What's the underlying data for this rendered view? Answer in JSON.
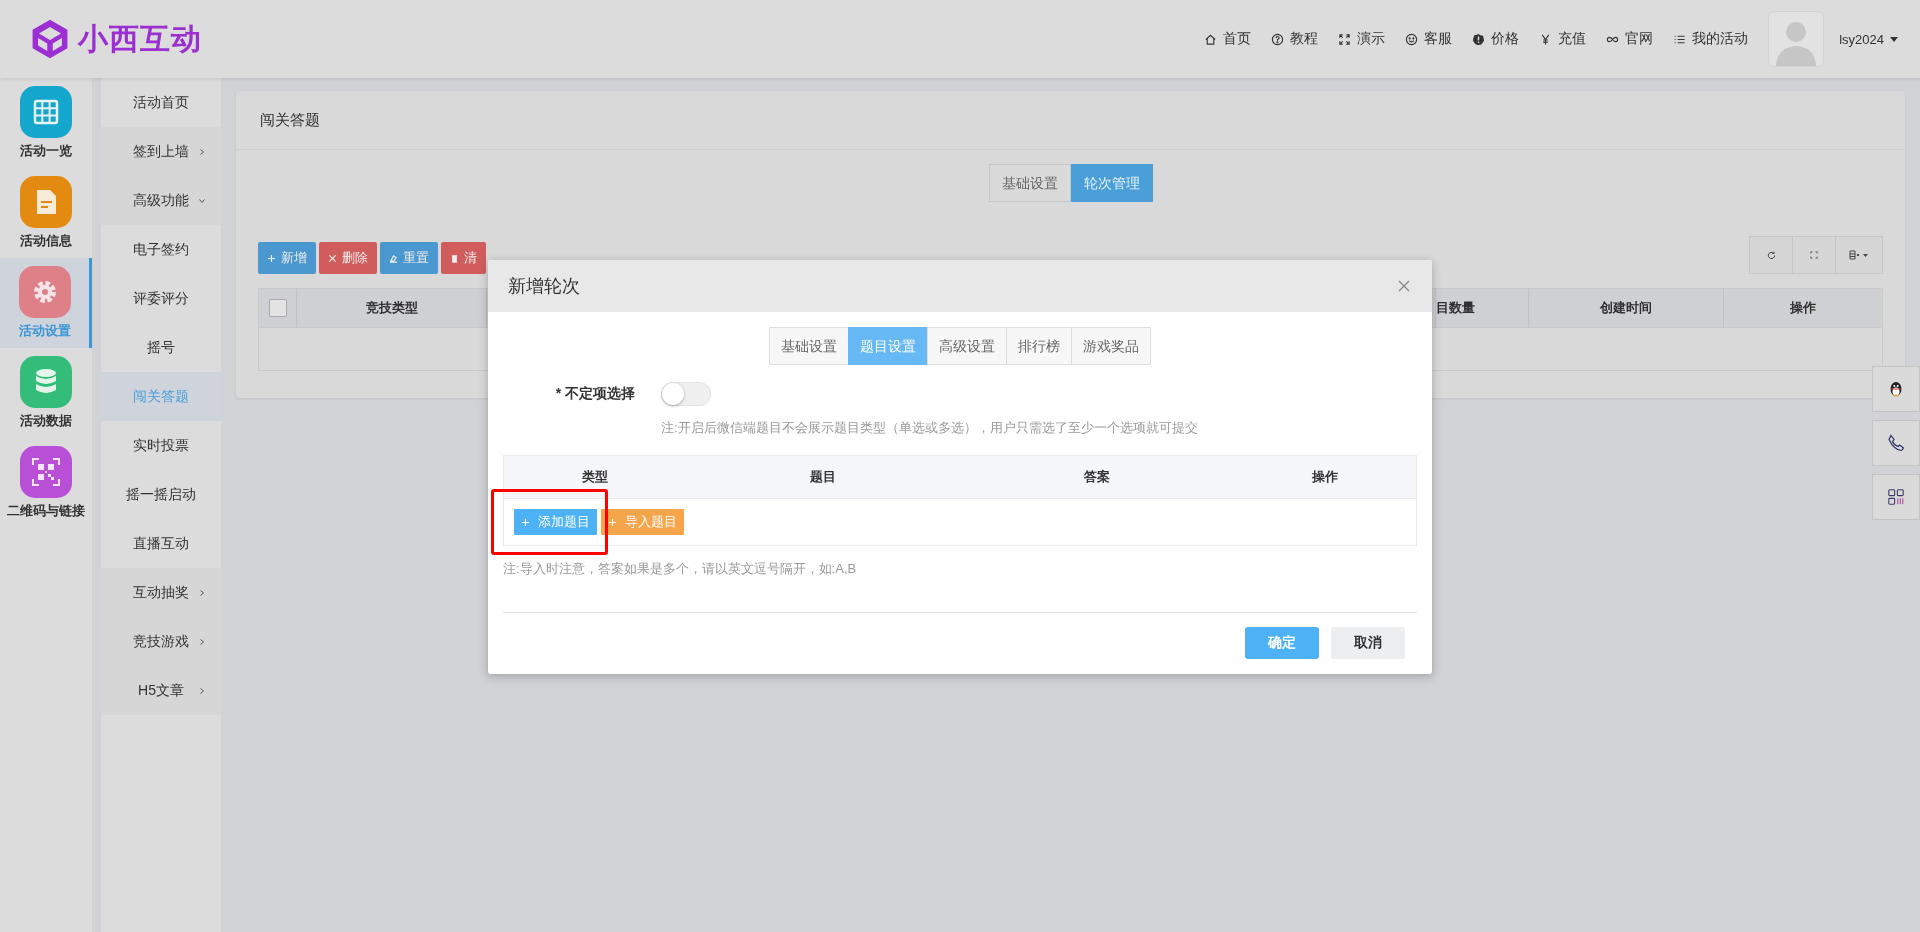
{
  "logo": {
    "text": "小西互动"
  },
  "top_nav": [
    {
      "kind": "home",
      "label": "首页"
    },
    {
      "kind": "help",
      "label": "教程"
    },
    {
      "kind": "expand",
      "label": "演示"
    },
    {
      "kind": "smile",
      "label": "客服"
    },
    {
      "kind": "alert",
      "label": "价格"
    },
    {
      "kind": "yen",
      "label": "充值"
    },
    {
      "kind": "infinity",
      "label": "官网"
    },
    {
      "kind": "list",
      "label": "我的活动"
    }
  ],
  "user": {
    "name": "lsy2024"
  },
  "app_nav": [
    {
      "kind": "grid",
      "label": "活动一览",
      "color": "#14a6cc",
      "selected": false
    },
    {
      "kind": "doc",
      "label": "活动信息",
      "color": "#e38a10",
      "selected": false
    },
    {
      "kind": "gear",
      "label": "活动设置",
      "color": "#de8088",
      "selected": true
    },
    {
      "kind": "database",
      "label": "活动数据",
      "color": "#33bd79",
      "selected": false
    },
    {
      "kind": "qr",
      "label": "二维码与链接",
      "color": "#b84fd6",
      "selected": false
    }
  ],
  "sub_nav": [
    {
      "kind": "link",
      "label": "活动首页",
      "selected": false
    },
    {
      "kind": "group",
      "label": "签到上墙",
      "expanded": false
    },
    {
      "kind": "group",
      "label": "高级功能",
      "expanded": true,
      "children": [
        {
          "label": "电子签约",
          "selected": false
        },
        {
          "label": "评委评分",
          "selected": false
        },
        {
          "label": "摇号",
          "selected": false
        },
        {
          "label": "闯关答题",
          "selected": true
        },
        {
          "label": "实时投票",
          "selected": false
        },
        {
          "label": "摇一摇启动",
          "selected": false
        },
        {
          "label": "直播互动",
          "selected": false
        }
      ]
    },
    {
      "kind": "group",
      "label": "互动抽奖",
      "expanded": false
    },
    {
      "kind": "group",
      "label": "竞技游戏",
      "expanded": false
    },
    {
      "kind": "group",
      "label": "H5文章",
      "expanded": false
    }
  ],
  "page": {
    "title": "闯关答题",
    "tabs": [
      {
        "label": "基础设置",
        "selected": false
      },
      {
        "label": "轮次管理",
        "selected": true
      }
    ],
    "toolbar": [
      {
        "kind": "add",
        "label": "新增"
      },
      {
        "kind": "delete",
        "label": "删除"
      },
      {
        "kind": "reset",
        "label": "重置"
      },
      {
        "kind": "clear",
        "label": "清"
      }
    ],
    "table": {
      "checked": false,
      "columns": [
        "竞技类型",
        "目数量",
        "创建时间",
        "操作"
      ]
    }
  },
  "dialog": {
    "title": "新增轮次",
    "tabs": [
      {
        "label": "基础设置",
        "selected": false
      },
      {
        "label": "题目设置",
        "selected": true
      },
      {
        "label": "高级设置",
        "selected": false
      },
      {
        "label": "排行榜",
        "selected": false
      },
      {
        "label": "游戏奖品",
        "selected": false
      }
    ],
    "toggle": {
      "label": "* 不定项选择",
      "on": false
    },
    "note": "注:开启后微信端题目不会展示题目类型（单选或多选），用户只需选了至少一个选项就可提交",
    "table": {
      "columns": [
        "类型",
        "题目",
        "答案",
        "操作"
      ]
    },
    "actions": [
      {
        "kind": "primary",
        "label": "添加题目"
      },
      {
        "kind": "warning",
        "label": "导入题目"
      }
    ],
    "import_note": "注:导入时注意，答案如果是多个，请以英文逗号隔开，如:A,B",
    "buttons": [
      {
        "kind": "primary",
        "label": "确定"
      },
      {
        "kind": "default",
        "label": "取消"
      }
    ]
  }
}
